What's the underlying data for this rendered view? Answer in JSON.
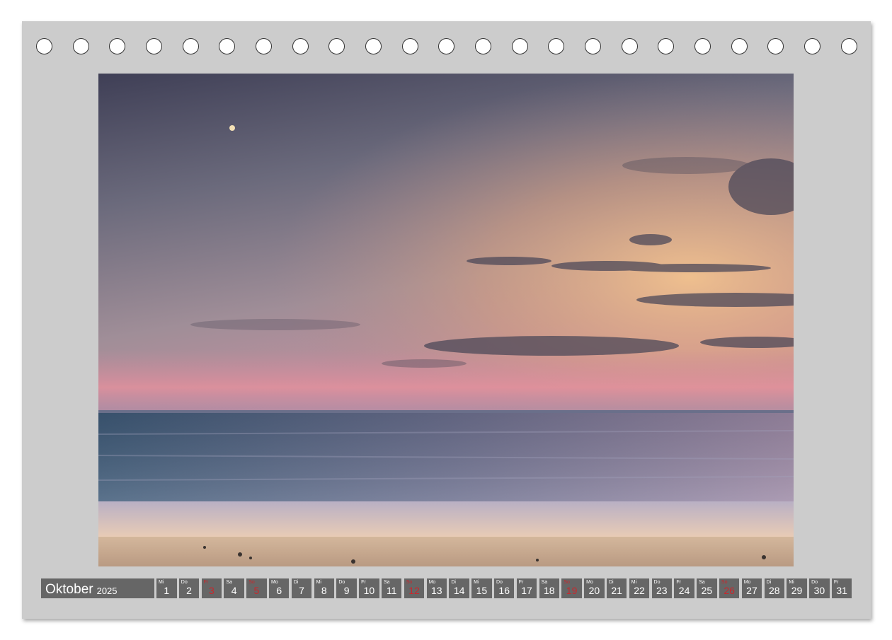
{
  "calendar": {
    "month": "Oktober",
    "year": "2025",
    "holes_count": 23,
    "colors": {
      "sheet": "#cccccc",
      "cell": "#666666",
      "text": "#ffffff",
      "sunday": "#c8282d"
    },
    "days": [
      {
        "wd": "Mi",
        "num": "1",
        "sun": false
      },
      {
        "wd": "Do",
        "num": "2",
        "sun": false
      },
      {
        "wd": "Fr",
        "num": "3",
        "sun": true
      },
      {
        "wd": "Sa",
        "num": "4",
        "sun": false
      },
      {
        "wd": "So",
        "num": "5",
        "sun": true
      },
      {
        "wd": "Mo",
        "num": "6",
        "sun": false
      },
      {
        "wd": "Di",
        "num": "7",
        "sun": false
      },
      {
        "wd": "Mi",
        "num": "8",
        "sun": false
      },
      {
        "wd": "Do",
        "num": "9",
        "sun": false
      },
      {
        "wd": "Fr",
        "num": "10",
        "sun": false
      },
      {
        "wd": "Sa",
        "num": "11",
        "sun": false
      },
      {
        "wd": "So",
        "num": "12",
        "sun": true
      },
      {
        "wd": "Mo",
        "num": "13",
        "sun": false
      },
      {
        "wd": "Di",
        "num": "14",
        "sun": false
      },
      {
        "wd": "Mi",
        "num": "15",
        "sun": false
      },
      {
        "wd": "Do",
        "num": "16",
        "sun": false
      },
      {
        "wd": "Fr",
        "num": "17",
        "sun": false
      },
      {
        "wd": "Sa",
        "num": "18",
        "sun": false
      },
      {
        "wd": "So",
        "num": "19",
        "sun": true
      },
      {
        "wd": "Mo",
        "num": "20",
        "sun": false
      },
      {
        "wd": "Di",
        "num": "21",
        "sun": false
      },
      {
        "wd": "Mi",
        "num": "22",
        "sun": false
      },
      {
        "wd": "Do",
        "num": "23",
        "sun": false
      },
      {
        "wd": "Fr",
        "num": "24",
        "sun": false
      },
      {
        "wd": "Sa",
        "num": "25",
        "sun": false
      },
      {
        "wd": "So",
        "num": "26",
        "sun": true
      },
      {
        "wd": "Mo",
        "num": "27",
        "sun": false
      },
      {
        "wd": "Di",
        "num": "28",
        "sun": false
      },
      {
        "wd": "Mi",
        "num": "29",
        "sun": false
      },
      {
        "wd": "Do",
        "num": "30",
        "sun": false
      },
      {
        "wd": "Fr",
        "num": "31",
        "sun": false
      }
    ]
  }
}
